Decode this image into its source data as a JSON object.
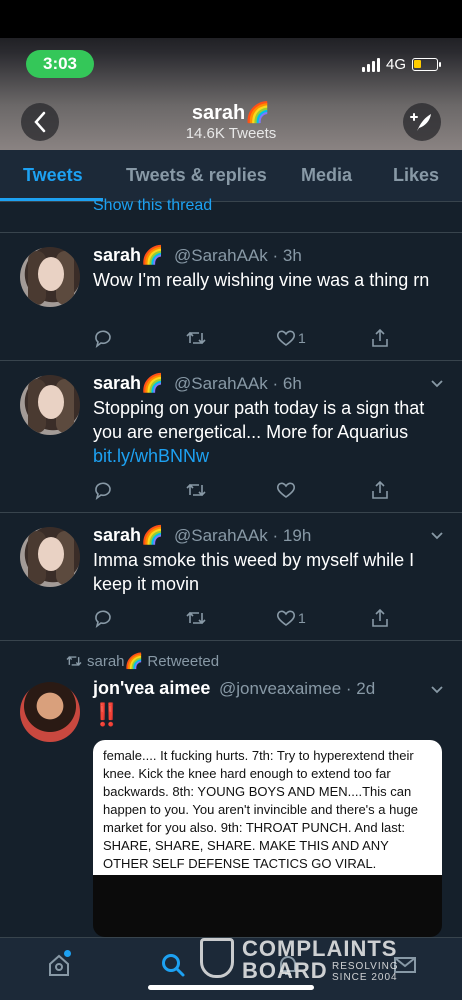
{
  "status_bar": {
    "time": "3:03",
    "network": "4G",
    "battery_level": 0.35
  },
  "header": {
    "name": "sarah🌈",
    "tweet_count": "14.6K Tweets"
  },
  "tabs": [
    {
      "label": "Tweets",
      "active": true
    },
    {
      "label": "Tweets & replies",
      "active": false
    },
    {
      "label": "Media",
      "active": false
    },
    {
      "label": "Likes",
      "active": false
    }
  ],
  "show_thread": "Show this thread",
  "tweets": [
    {
      "name": "sarah🌈",
      "handle": "@SarahAAk · 3h",
      "text": "Wow I'm really wishing vine was a thing rn",
      "likes": "1"
    },
    {
      "name": "sarah🌈",
      "handle": "@SarahAAk · 6h",
      "text": "Stopping on your path today is a sign that you are energetical... More for Aquarius ",
      "link": "bit.ly/whBNNw",
      "likes": ""
    },
    {
      "name": "sarah🌈",
      "handle": "@SarahAAk · 19h",
      "text": "Imma smoke this weed by myself while I keep it movin",
      "likes": "1"
    }
  ],
  "retweet": {
    "retweeted_by": "sarah🌈 Retweeted",
    "name": "jon'vea aimee",
    "handle": "@jonveaxaimee · 2d",
    "text": "‼️",
    "media_text": "female.... It fucking hurts. 7th: Try to hyperextend their knee. Kick the knee hard enough to extend too far backwards. 8th: YOUNG BOYS AND MEN....This can happen to you. You aren't invincible and there's a huge market for you also. 9th: THROAT PUNCH. And last: SHARE, SHARE, SHARE. MAKE THIS AND ANY OTHER SELF DEFENSE TACTICS GO VIRAL."
  },
  "watermark": {
    "line1": "COMPLAINTS",
    "line2": "BOARD",
    "tag1": "RESOLVING",
    "tag2": "SINCE 2004"
  },
  "colors": {
    "accent": "#1da1f2",
    "background": "#15202b",
    "muted": "#8899a6"
  }
}
